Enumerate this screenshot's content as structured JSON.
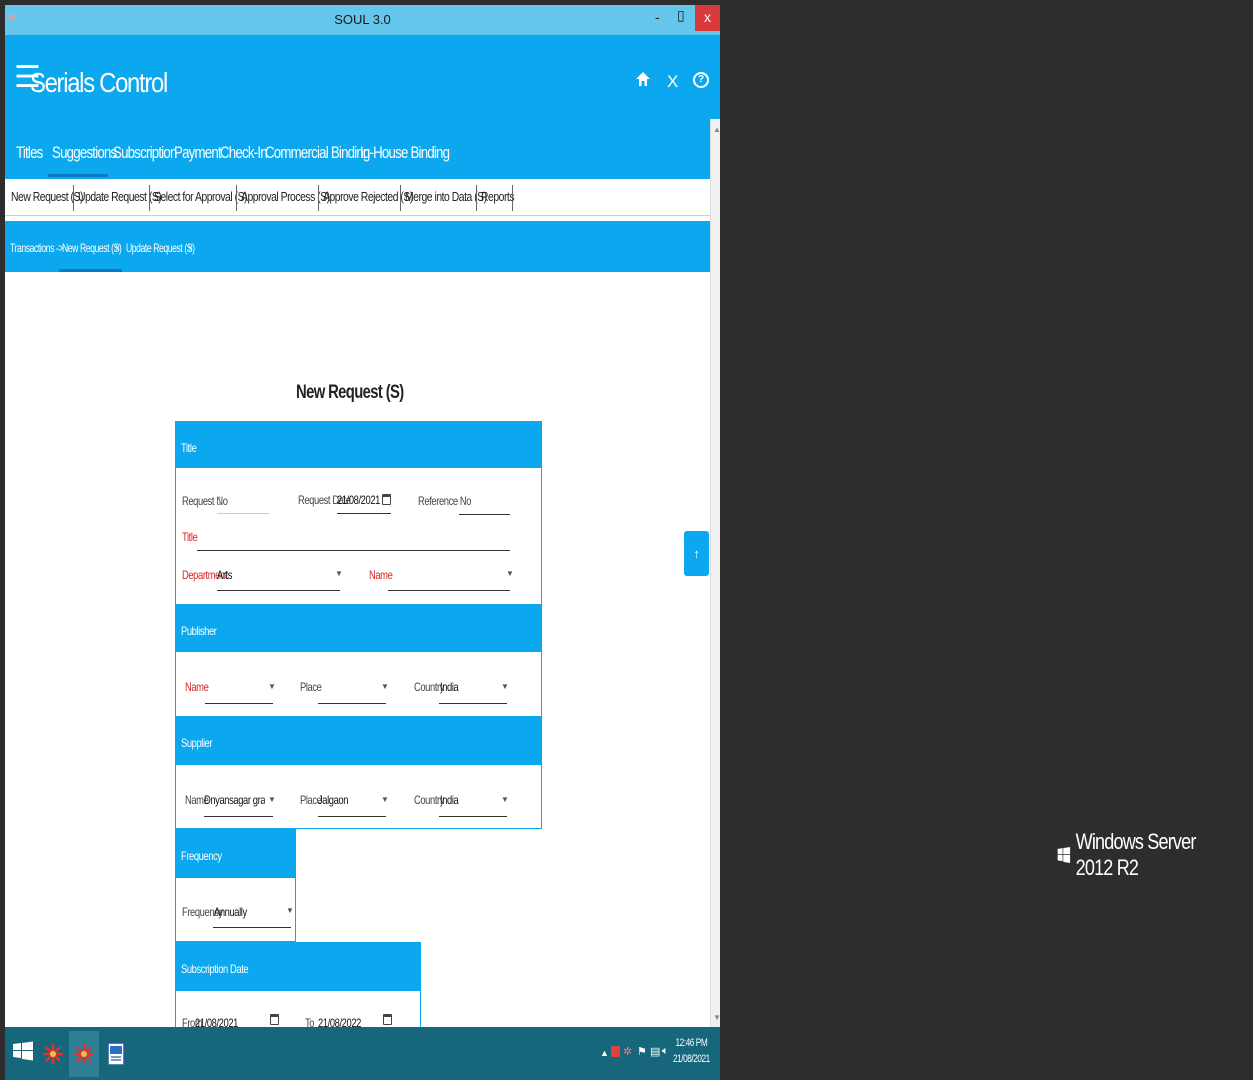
{
  "window": {
    "title": "SOUL 3.0",
    "min": "-",
    "max": "▯",
    "close": "x"
  },
  "header": {
    "menu_glyph": "☰",
    "title": "Serials Control",
    "home": "⌂",
    "close": "X",
    "help": "?"
  },
  "nav": [
    "Titles",
    "Suggestions",
    "Subscription",
    "Payment",
    "Check-In",
    "Commercial Binding",
    "In-House Binding"
  ],
  "subtabs": [
    "New Request (S)",
    "Update Request (S)",
    "Select for Approval (S)",
    "Approval Process (S)",
    "Approve Rejected (S)",
    "Merge into Data (S)",
    "Reports"
  ],
  "breadcrumb": {
    "root": "Transactions ->",
    "tab1": "New Request (S)",
    "tab1_close": "×",
    "tab2": "Update Request (S)",
    "tab2_close": "×"
  },
  "page_heading": "New Request (S)",
  "form": {
    "title_section": {
      "header": "Title",
      "request_no_label": "Request No",
      "request_no_value": "1",
      "request_date_label": "Request Date",
      "request_date_value": "21/08/2021",
      "reference_no_label": "Reference No",
      "reference_no_value": "",
      "title_label": "Title",
      "title_value": "",
      "department_label": "Department",
      "department_value": "Arts",
      "name_label": "Name",
      "name_value": ""
    },
    "publisher_section": {
      "header": "Publisher",
      "name_label": "Name",
      "name_value": "",
      "place_label": "Place",
      "place_value": "",
      "country_label": "Country",
      "country_value": "India"
    },
    "supplier_section": {
      "header": "Supplier",
      "name_label": "Name",
      "name_value": "Dnyansagar granth ye",
      "place_label": "Place",
      "place_value": "Jalgaon",
      "country_label": "Country",
      "country_value": "India"
    },
    "frequency_section": {
      "header": "Frequency",
      "frequency_label": "Frequency",
      "frequency_value": "Annually"
    },
    "subscription_section": {
      "header": "Subscription Date",
      "from_label": "From",
      "from_value": "21/08/2021",
      "to_label": "To",
      "to_value": "21/08/2022"
    }
  },
  "scroll_top": "↑",
  "taskbar": {
    "clock_time": "12:46 PM",
    "clock_date": "21/08/2021",
    "tray_arrow": "▲"
  },
  "desktop": {
    "brand": "Windows Server 2012 R2"
  },
  "colors": {
    "accent": "#0ba8ef",
    "titlebar": "#63c6ea",
    "taskbar": "#16667c",
    "required": "#e02020",
    "close": "#d73a3a"
  }
}
